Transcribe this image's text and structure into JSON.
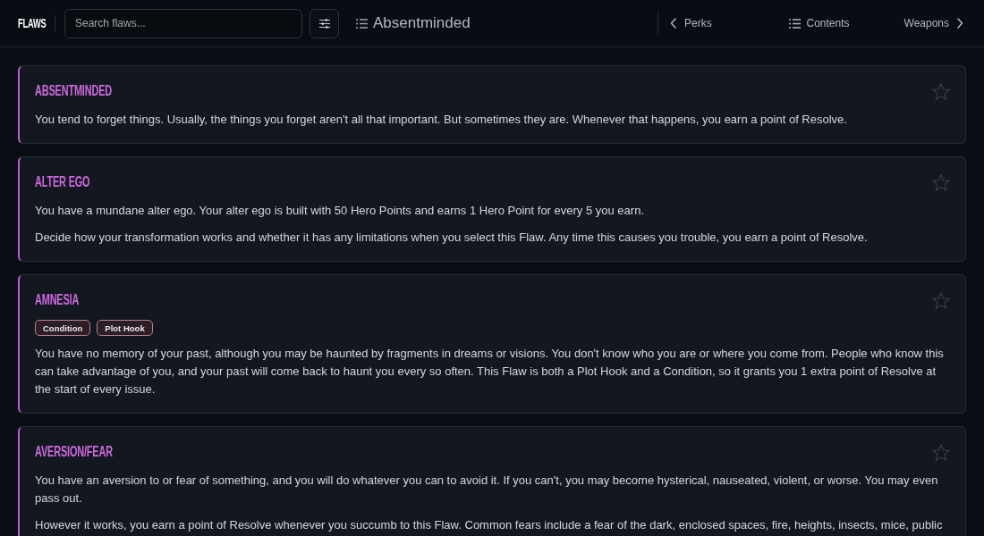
{
  "header": {
    "title": "FLAWS",
    "search": {
      "placeholder": "Search flaws..."
    },
    "current_section": "Absentminded",
    "nav": {
      "previous": "Perks",
      "contents": "Contents",
      "next": "Weapons"
    }
  },
  "flaws": [
    {
      "name": "ABSENTMINDED",
      "starred": false,
      "paragraphs": [
        "You tend to forget things. Usually, the things you forget aren't all that important. But sometimes they are. Whenever that happens, you earn a point of Resolve."
      ]
    },
    {
      "name": "ALTER EGO",
      "starred": false,
      "paragraphs": [
        "You have a mundane alter ego. Your alter ego is built with 50 Hero Points and earns 1 Hero Point for every 5 you earn.",
        "Decide how your transformation works and whether it has any limitations when you select this Flaw. Any time this causes you trouble, you earn a point of Resolve."
      ]
    },
    {
      "name": "AMNESIA",
      "starred": false,
      "tags": [
        "Condition",
        "Plot Hook"
      ],
      "paragraphs": [
        "You have no memory of your past, although you may be haunted by fragments in dreams or visions. You don't know who you are or where you come from. People who know this can take advantage of you, and your past will come back to haunt you every so often. This Flaw is both a Plot Hook and a Condition, so it grants you 1 extra point of Resolve at the start of every issue."
      ]
    },
    {
      "name": "AVERSION/FEAR",
      "starred": false,
      "paragraphs": [
        "You have an aversion to or fear of something, and you will do whatever you can to avoid it. If you can't, you may become hysterical, nauseated, violent, or worse. You may even pass out.",
        "However it works, you earn a point of Resolve whenever you succumb to this Flaw. Common fears include a fear of the dark, enclosed spaces, fire, heights, insects, mice, public"
      ]
    }
  ]
}
